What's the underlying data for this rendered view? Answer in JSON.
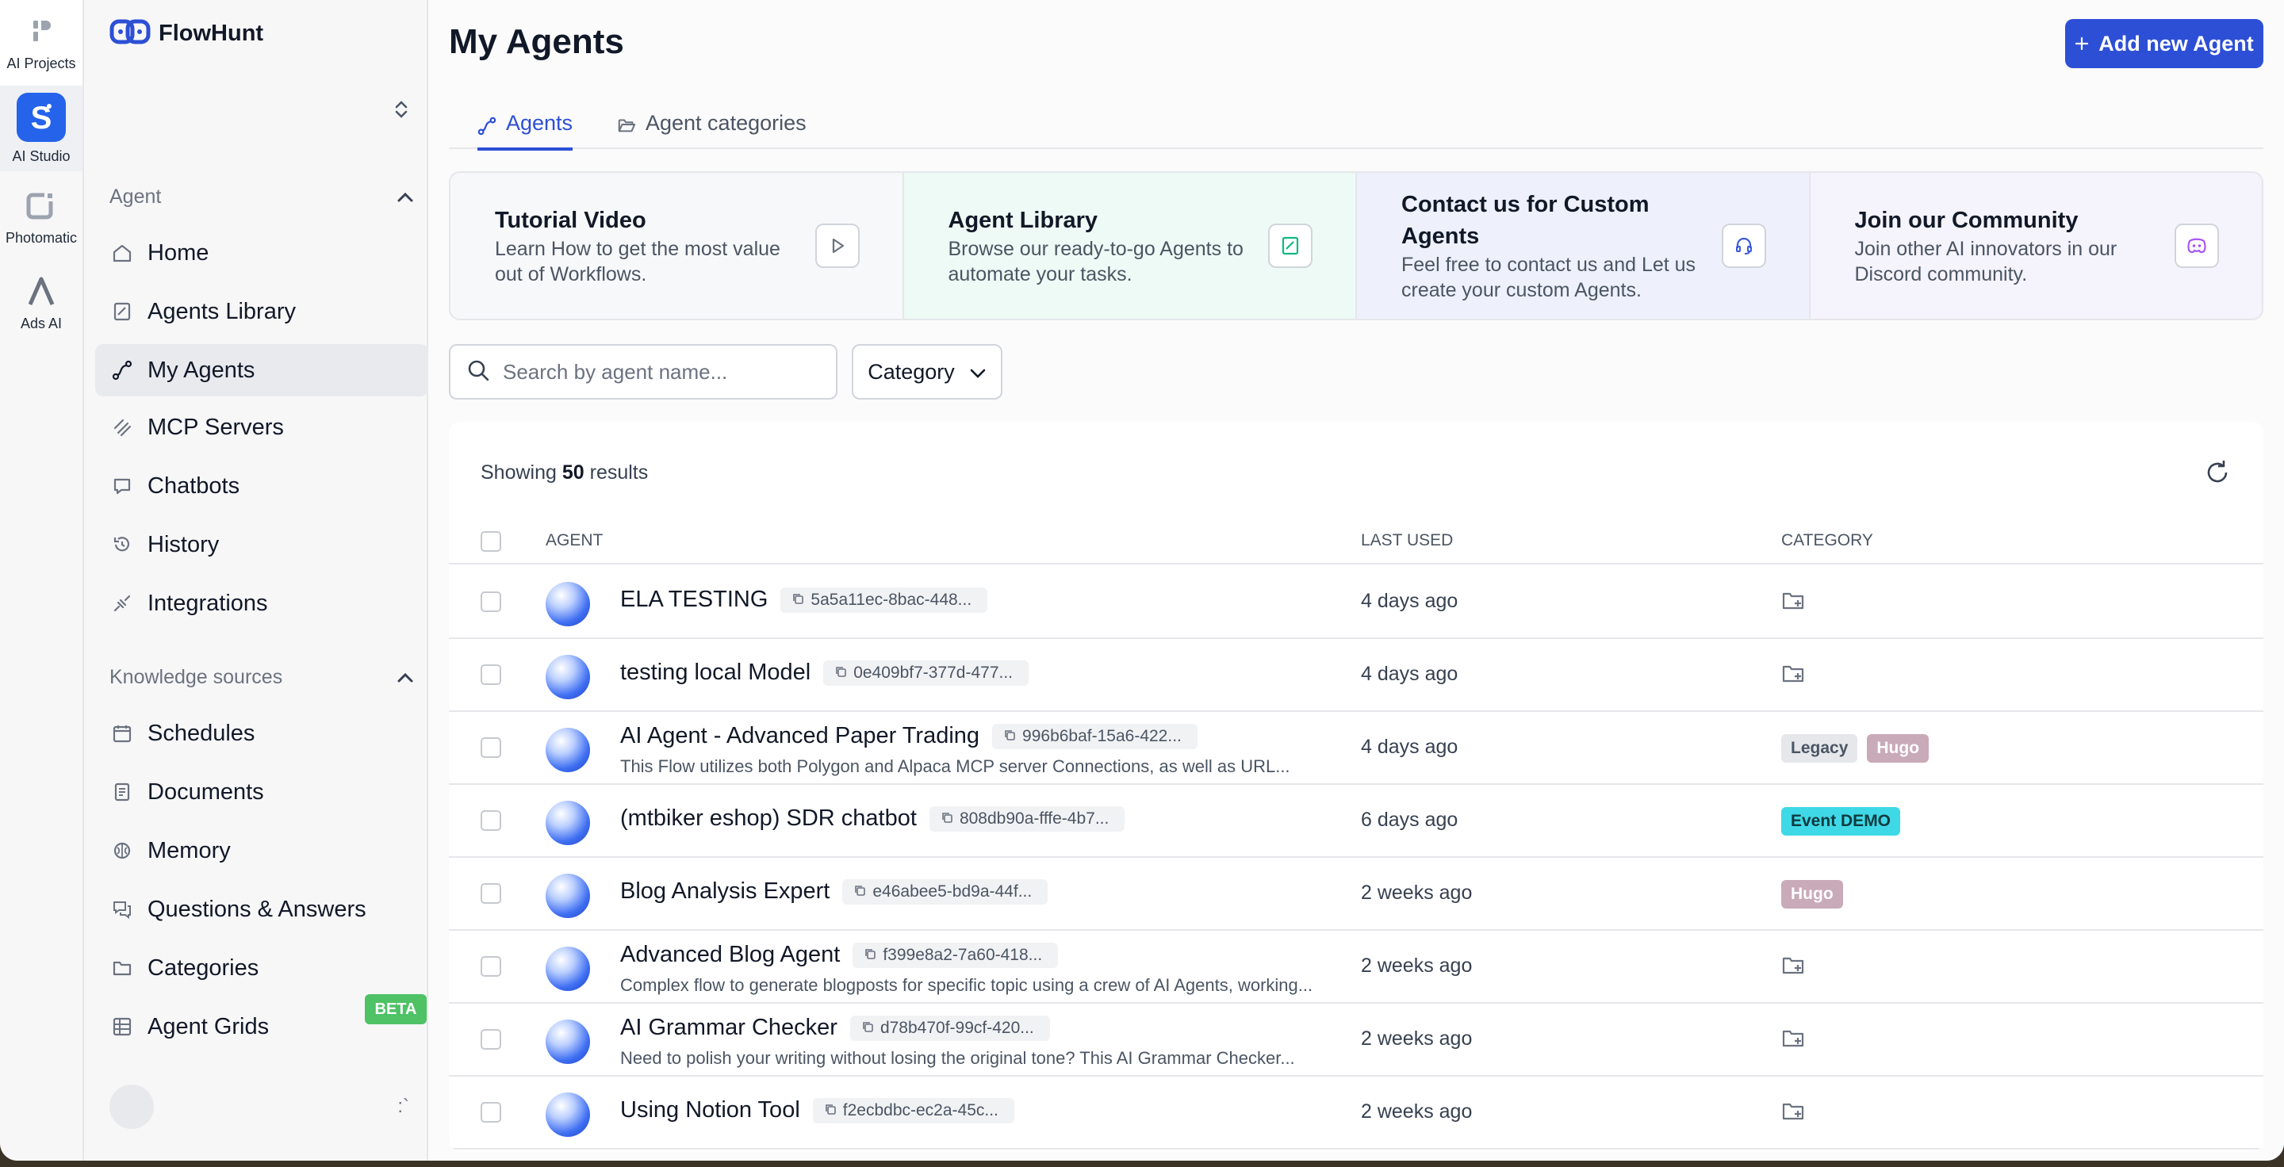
{
  "rail": {
    "items": [
      {
        "label": "AI Projects",
        "icon": "ai-projects-icon"
      },
      {
        "label": "AI Studio",
        "icon": "ai-studio-icon"
      },
      {
        "label": "Photomatic",
        "icon": "photomatic-icon"
      },
      {
        "label": "Ads AI",
        "icon": "ads-ai-icon"
      }
    ]
  },
  "sidebar": {
    "brand": "FlowHunt",
    "sections": {
      "agent": "Agent",
      "knowledge": "Knowledge sources"
    },
    "items": [
      {
        "label": "Home",
        "icon": "home-icon"
      },
      {
        "label": "Agents Library",
        "icon": "library-icon"
      },
      {
        "label": "My Agents",
        "icon": "flow-icon"
      },
      {
        "label": "MCP Servers",
        "icon": "mcp-icon"
      },
      {
        "label": "Chatbots",
        "icon": "chat-icon"
      },
      {
        "label": "History",
        "icon": "history-icon"
      },
      {
        "label": "Integrations",
        "icon": "plug-icon"
      },
      {
        "label": "Schedules",
        "icon": "calendar-icon"
      },
      {
        "label": "Documents",
        "icon": "document-icon"
      },
      {
        "label": "Memory",
        "icon": "brain-icon"
      },
      {
        "label": "Questions & Answers",
        "icon": "qa-icon"
      },
      {
        "label": "Categories",
        "icon": "folder-icon"
      },
      {
        "label": "Agent Grids",
        "icon": "grid-icon"
      }
    ],
    "beta_label": "BETA",
    "more_glyph": ":`"
  },
  "header": {
    "title": "My Agents",
    "add_button": "Add new Agent"
  },
  "tabs": [
    {
      "label": "Agents",
      "active": true
    },
    {
      "label": "Agent categories",
      "active": false
    }
  ],
  "cards": [
    {
      "title": "Tutorial Video",
      "desc": "Learn How to get the most value out of Workflows.",
      "bg": "#f7f8fa",
      "icon": "play-icon",
      "accent": "#6b7280"
    },
    {
      "title": "Agent Library",
      "desc": "Browse our ready-to-go Agents to automate your tasks.",
      "bg": "#eefaf5",
      "icon": "book-icon",
      "accent": "#10b981"
    },
    {
      "title": "Contact us for Custom Agents",
      "desc": "Feel free to contact us and Let us create your custom Agents.",
      "bg": "#eef1fb",
      "icon": "headset-icon",
      "accent": "#3b5bdb"
    },
    {
      "title": "Join our Community",
      "desc": "Join other AI innovators in our Discord community.",
      "bg": "#f5f3fb",
      "icon": "discord-icon",
      "accent": "#a855f7"
    }
  ],
  "search": {
    "placeholder": "Search by agent name..."
  },
  "filter": {
    "label": "Category"
  },
  "results": {
    "showing_prefix": "Showing",
    "count": "50",
    "showing_suffix": "results"
  },
  "table": {
    "columns": [
      "AGENT",
      "LAST USED",
      "CATEGORY"
    ],
    "rows": [
      {
        "name": "ELA TESTING",
        "id": "5a5a11ec-8bac-448...",
        "desc": "",
        "last_used": "4 days ago",
        "categories": []
      },
      {
        "name": "testing local Model",
        "id": "0e409bf7-377d-477...",
        "desc": "",
        "last_used": "4 days ago",
        "categories": []
      },
      {
        "name": "AI Agent - Advanced Paper Trading",
        "id": "996b6baf-15a6-422...",
        "desc": "This Flow utilizes both Polygon and Alpaca MCP server Connections, as well as URL...",
        "last_used": "4 days ago",
        "categories": [
          {
            "label": "Legacy",
            "bg": "#e5e7eb",
            "fg": "#4b5563"
          },
          {
            "label": "Hugo",
            "bg": "#c9aab8",
            "fg": "#ffffff"
          }
        ]
      },
      {
        "name": "(mtbiker eshop) SDR chatbot",
        "id": "808db90a-fffe-4b7...",
        "desc": "",
        "last_used": "6 days ago",
        "categories": [
          {
            "label": "Event DEMO",
            "bg": "#3fd8e6",
            "fg": "#0f3b40"
          }
        ]
      },
      {
        "name": "Blog Analysis Expert",
        "id": "e46abee5-bd9a-44f...",
        "desc": "",
        "last_used": "2 weeks ago",
        "categories": [
          {
            "label": "Hugo",
            "bg": "#c9aab8",
            "fg": "#ffffff"
          }
        ]
      },
      {
        "name": "Advanced Blog Agent",
        "id": "f399e8a2-7a60-418...",
        "desc": "Complex flow to generate blogposts for specific topic using a crew of AI Agents, working...",
        "last_used": "2 weeks ago",
        "categories": []
      },
      {
        "name": "AI Grammar Checker",
        "id": "d78b470f-99cf-420...",
        "desc": "Need to polish your writing without losing the original tone? This AI Grammar Checker...",
        "last_used": "2 weeks ago",
        "categories": []
      },
      {
        "name": "Using Notion Tool",
        "id": "f2ecbdbc-ec2a-45c...",
        "desc": "",
        "last_used": "2 weeks ago",
        "categories": []
      }
    ]
  }
}
